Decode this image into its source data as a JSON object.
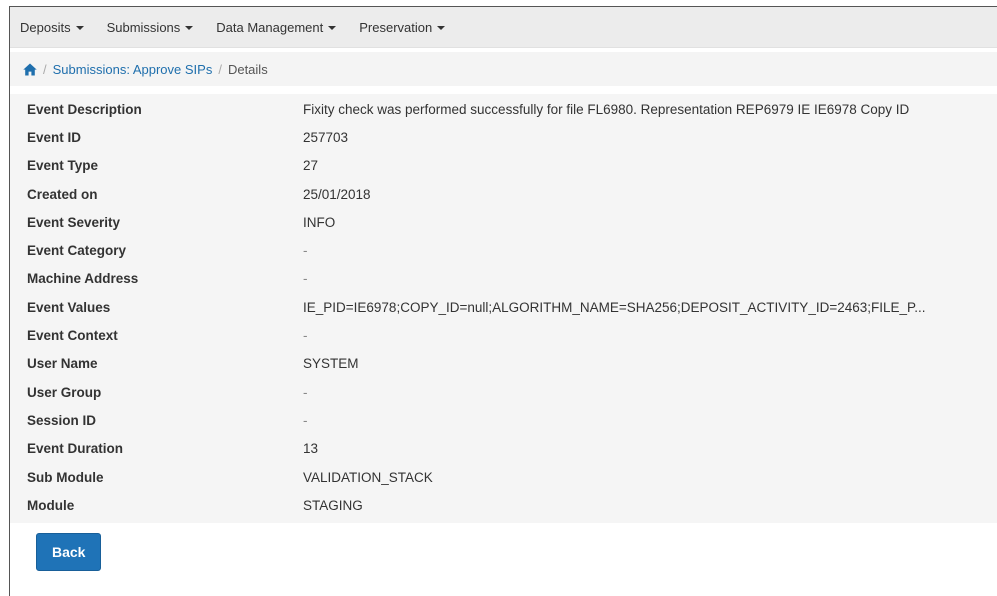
{
  "nav": {
    "items": [
      {
        "label": "Deposits"
      },
      {
        "label": "Submissions"
      },
      {
        "label": "Data Management"
      },
      {
        "label": "Preservation"
      }
    ]
  },
  "breadcrumb": {
    "link": "Submissions: Approve SIPs",
    "separator": "/",
    "current": "Details"
  },
  "details": {
    "rows": [
      {
        "label": "Event Description",
        "value": "Fixity check was performed successfully for file FL6980. Representation REP6979 IE IE6978 Copy ID"
      },
      {
        "label": "Event ID",
        "value": "257703"
      },
      {
        "label": "Event Type",
        "value": "27"
      },
      {
        "label": "Created on",
        "value": "25/01/2018"
      },
      {
        "label": "Event Severity",
        "value": "INFO"
      },
      {
        "label": "Event Category",
        "value": "-"
      },
      {
        "label": "Machine Address",
        "value": "-"
      },
      {
        "label": "Event Values",
        "value": "IE_PID=IE6978;COPY_ID=null;ALGORITHM_NAME=SHA256;DEPOSIT_ACTIVITY_ID=2463;FILE_P..."
      },
      {
        "label": "Event Context",
        "value": "-"
      },
      {
        "label": "User Name",
        "value": "SYSTEM"
      },
      {
        "label": "User Group",
        "value": "-"
      },
      {
        "label": "Session ID",
        "value": "-"
      },
      {
        "label": "Event Duration",
        "value": "13"
      },
      {
        "label": "Sub Module",
        "value": "VALIDATION_STACK"
      },
      {
        "label": "Module",
        "value": "STAGING"
      }
    ]
  },
  "footer": {
    "back_label": "Back"
  },
  "colors": {
    "link": "#1f6fad",
    "button": "#1f73b7",
    "nav_bg": "#ececec",
    "panel_bg": "#f5f5f5"
  }
}
